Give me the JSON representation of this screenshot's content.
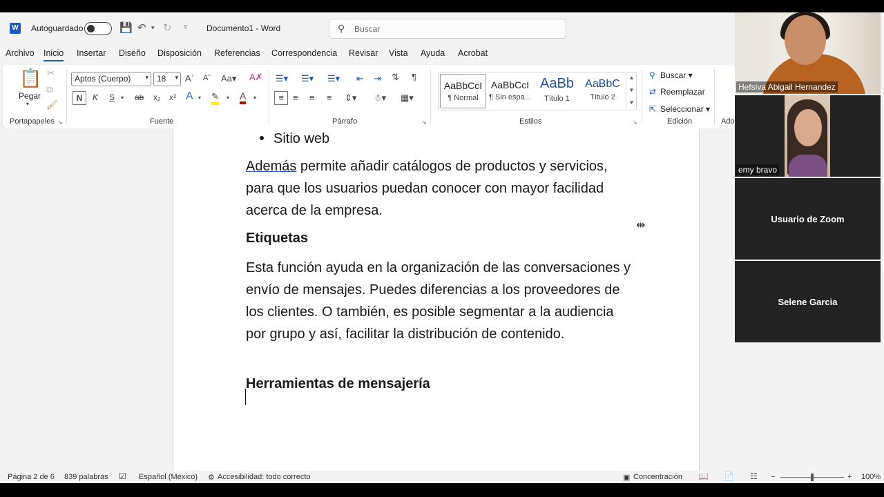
{
  "titlebar": {
    "app_letter": "W",
    "autosave_label": "Autoguardado",
    "document_title": "Documento1  -  Word",
    "search_placeholder": "Buscar"
  },
  "menu": {
    "tabs": [
      "Archivo",
      "Inicio",
      "Insertar",
      "Diseño",
      "Disposición",
      "Referencias",
      "Correspondencia",
      "Revisar",
      "Vista",
      "Ayuda",
      "Acrobat"
    ],
    "active": "Inicio"
  },
  "ribbon": {
    "clipboard": {
      "paste_label": "Pegar",
      "group_label": "Portapapeles"
    },
    "font": {
      "font_name": "Aptos (Cuerpo)",
      "font_size": "18",
      "group_label": "Fuente",
      "bold": "N",
      "italic": "K",
      "underline": "S"
    },
    "paragraph": {
      "group_label": "Párrafo"
    },
    "styles": {
      "group_label": "Estilos",
      "items": [
        {
          "preview": "AaBbCcI",
          "name": "¶ Normal"
        },
        {
          "preview": "AaBbCcI",
          "name": "¶ Sin espa..."
        },
        {
          "preview": "AaBb",
          "name": "Título 1"
        },
        {
          "preview": "AaBbC",
          "name": "Título 2"
        }
      ]
    },
    "editing": {
      "group_label": "Edición",
      "find": "Buscar",
      "replace": "Reemplazar",
      "select": "Seleccionar"
    },
    "addins_label": "Ado"
  },
  "document": {
    "bullet_item": "Sitio web",
    "para1_first_word": "Además",
    "para1_rest": " permite añadir catálogos de productos y servicios, para que los usuarios puedan conocer con mayor facilidad acerca de la empresa.",
    "heading1": "Etiquetas",
    "para2": "Esta función ayuda en la organización de las conversaciones y envío de mensajes. Puedes diferencias a los proveedores de los clientes. O también, es posible segmentar a la audiencia por grupo y así, facilitar la distribución de contenido.",
    "heading2": "Herramientas de mensajería"
  },
  "status": {
    "page": "Página 2 de 6",
    "words": "839 palabras",
    "language": "Español (México)",
    "accessibility": "Accesibilidad: todo correcto",
    "focus": "Concentración",
    "zoom": "100%"
  },
  "zoom_participants": [
    {
      "name": "Hefsiva Abigail Hernandez"
    },
    {
      "name": "emy bravo"
    },
    {
      "name": "Usuario de Zoom"
    },
    {
      "name": "Selene Garcia"
    }
  ],
  "colors": {
    "word_blue": "#185abd",
    "ribbon_bg": "#ffffff",
    "app_bg": "#f3f3f3",
    "zoom_tile": "#232323"
  }
}
